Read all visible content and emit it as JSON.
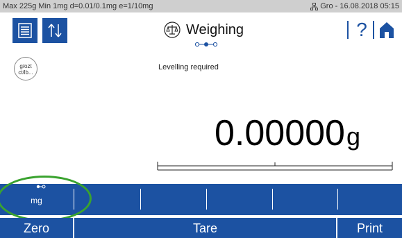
{
  "status_bar": {
    "left": "Max 225g  Min 1mg  d=0.01/0.1mg  e=1/10mg",
    "right": "Gro  -  16.08.2018 05:15"
  },
  "header": {
    "title": "Weighing",
    "help": "?"
  },
  "unit_icon": {
    "text": "g/ozt\nct/lb..."
  },
  "main": {
    "status_message": "Levelling required",
    "weight_value": "0.00000",
    "weight_unit": "g"
  },
  "function_keys": {
    "mg_label": "mg"
  },
  "actions": {
    "zero": "Zero",
    "tare": "Tare",
    "print": "Print"
  },
  "colors": {
    "accent": "#1c52a2",
    "highlight": "#3aa32f",
    "status_bar": "#cfcfcf"
  }
}
